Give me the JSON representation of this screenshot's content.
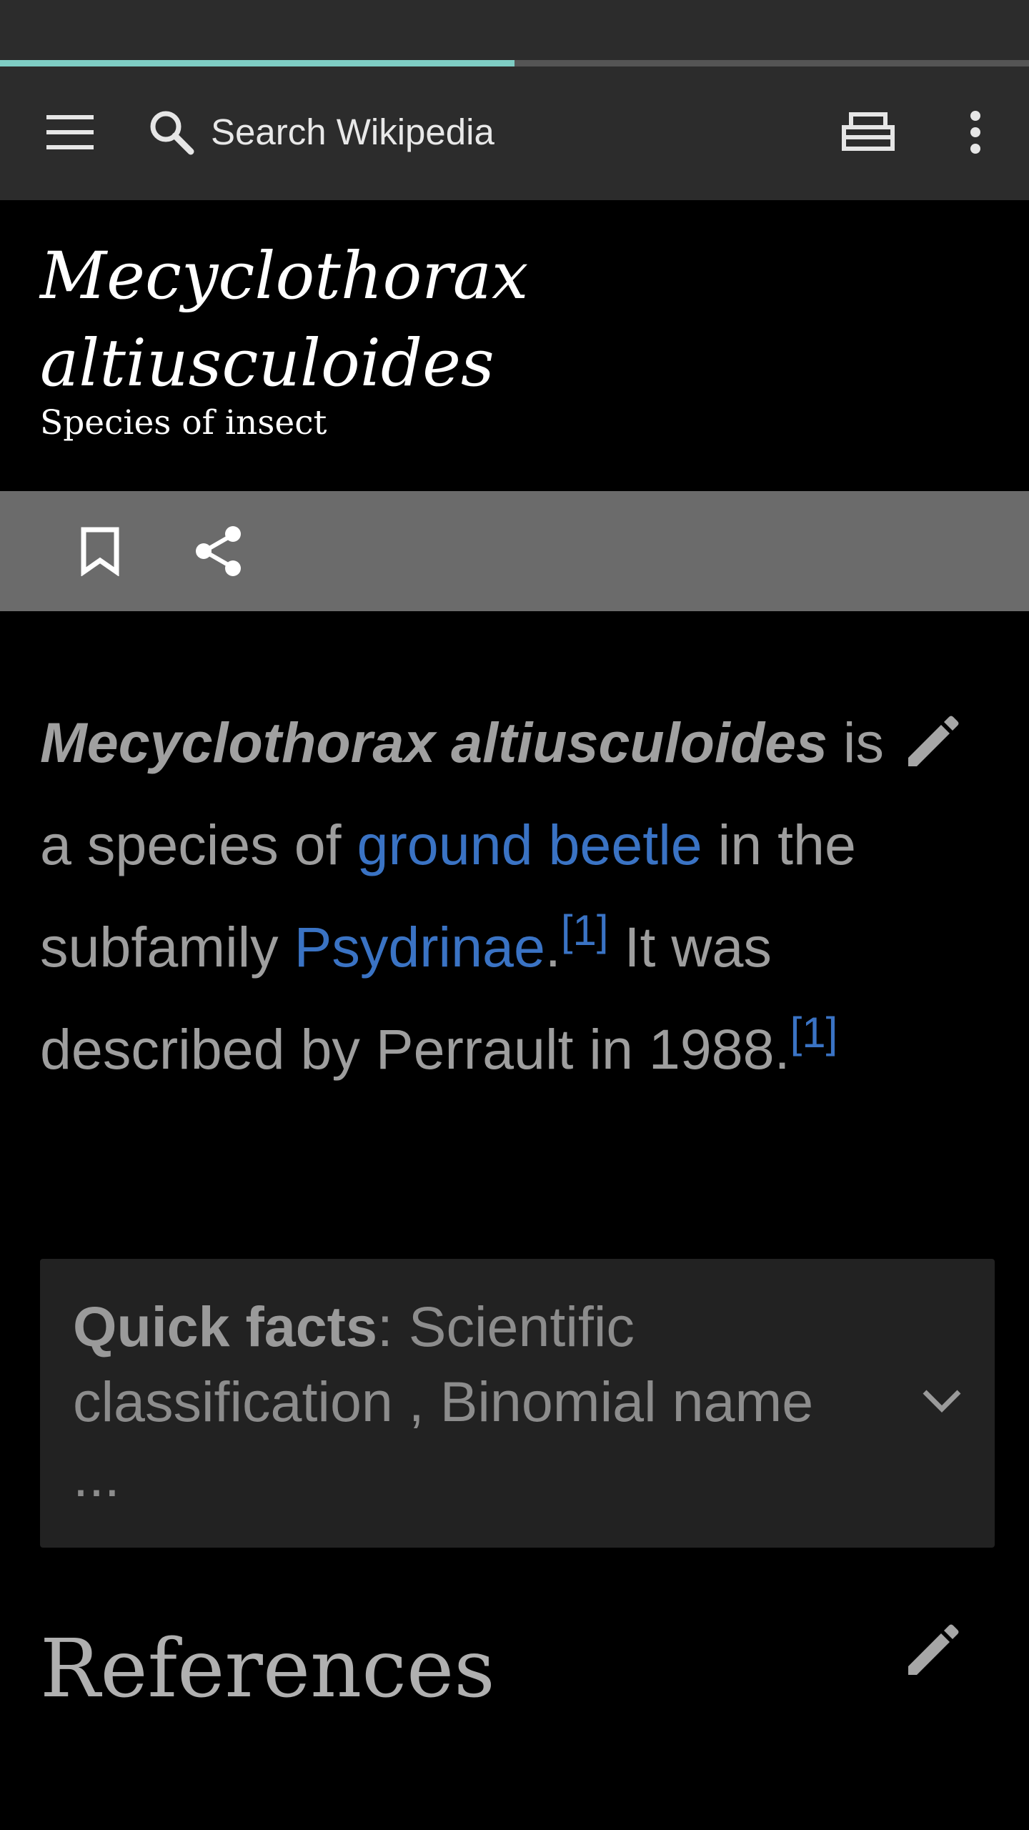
{
  "colors": {
    "toolbar_bg": "#2c2c2c",
    "progress_fill": "#7fcdc4",
    "action_bar_bg": "#6b6b6b",
    "link": "#3a73c4",
    "body_text": "#9e9e9e",
    "quick_facts_bg": "#222222"
  },
  "page_load_progress": 0.5,
  "toolbar": {
    "menu_icon": "hamburger-menu-icon",
    "search_icon": "search-icon",
    "search_placeholder": "Search Wikipedia",
    "tabs_icon": "tabs-icon",
    "overflow_icon": "more-vertical-icon"
  },
  "article": {
    "title_line1": "Mecyclothorax",
    "title_line2": "altiusculoides",
    "description": "Species of insect"
  },
  "actions": {
    "bookmark_icon": "bookmark-icon",
    "share_icon": "share-icon"
  },
  "lead": {
    "name": "Mecyclothorax altiusculoides",
    "text1": " is a species of ",
    "link1": "ground beetle",
    "text2": " in the subfamily ",
    "link2": "Psydrinae",
    "text3": ".",
    "ref1": "[1]",
    "text4": " It was described by Perrault in 1988.",
    "ref2": "[1]",
    "edit_icon": "pencil-edit-icon"
  },
  "quick_facts": {
    "label": "Quick facts",
    "text": ": Scientific classification , Binomial name ...",
    "chevron_icon": "chevron-down-icon"
  },
  "references": {
    "heading": "References",
    "edit_icon": "pencil-edit-icon"
  }
}
